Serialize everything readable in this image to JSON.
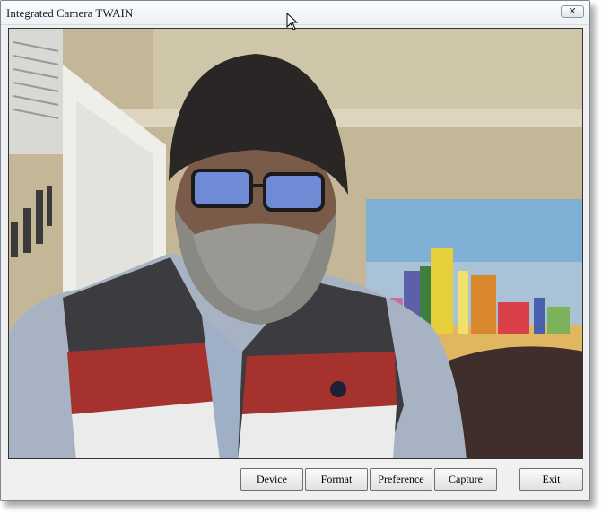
{
  "window": {
    "title": "Integrated Camera TWAIN",
    "close_glyph": "✕"
  },
  "buttons": {
    "device": "Device",
    "format": "Format",
    "preference": "Preference",
    "capture": "Capture",
    "exit": "Exit"
  },
  "preview": {
    "description": "live-camera-preview"
  },
  "icons": {
    "close": "close-icon",
    "cursor": "mouse-pointer-icon"
  },
  "colors": {
    "frame": "#f0f0f0",
    "titlebar": "#edf1f5",
    "button": "#e1e1e1"
  }
}
